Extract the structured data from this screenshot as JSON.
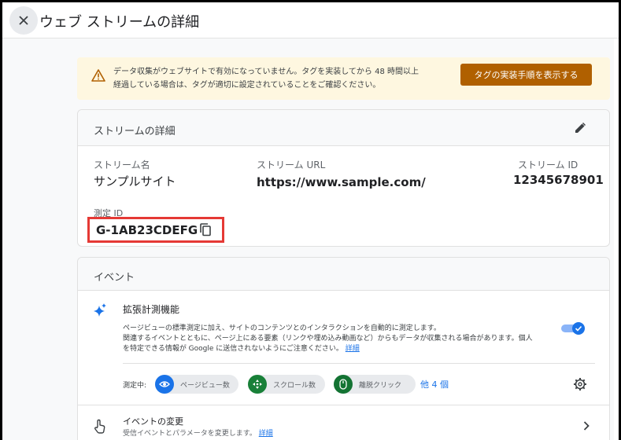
{
  "header": {
    "title": "ウェブ ストリームの詳細"
  },
  "banner": {
    "line1": "データ収集がウェブサイトで有効になっていません。タグを実装してから 48 時間以上",
    "line2": "経過している場合は、タグが適切に設定されていることをご確認ください。",
    "button_label": "タグの実装手順を表示する"
  },
  "stream": {
    "card_title": "ストリームの詳細",
    "name_label": "ストリーム名",
    "name_value": "サンプルサイト",
    "url_label": "ストリーム URL",
    "url_value": "https://www.sample.com/",
    "id_label": "ストリーム ID",
    "id_value": "12345678901",
    "measurement_label": "測定 ID",
    "measurement_value": "G-1AB23CDEFG"
  },
  "events": {
    "card_title": "イベント",
    "enhanced_title": "拡張計測機能",
    "enhanced_desc_1": "ページビューの標準測定に加え、サイトのコンテンツとのインタラクションを自動的に測定します。",
    "enhanced_desc_2": "関連するイベントとともに、ページ上にある要素（リンクや埋め込み動画など）からもデータが収集される場合があります。個人",
    "enhanced_desc_3": "を特定できる情報が Google に送信されないようにご注意ください。",
    "enhanced_link": "詳細",
    "enhanced_enabled": true,
    "measuring_label": "測定中:",
    "chips": [
      {
        "label": "ページビュー数",
        "icon": "eye-icon"
      },
      {
        "label": "スクロール数",
        "icon": "scroll-icon"
      },
      {
        "label": "離脱クリック",
        "icon": "mouse-icon"
      }
    ],
    "more_label": "他 4 個",
    "modify_title": "イベントの変更",
    "modify_desc": "受信イベントとパラメータを変更します。",
    "modify_link": "詳細"
  },
  "colors": {
    "accent": "#1a73e8",
    "warning_bg": "#fef7e0",
    "warning_button": "#b06000",
    "highlight": "#e53935"
  }
}
